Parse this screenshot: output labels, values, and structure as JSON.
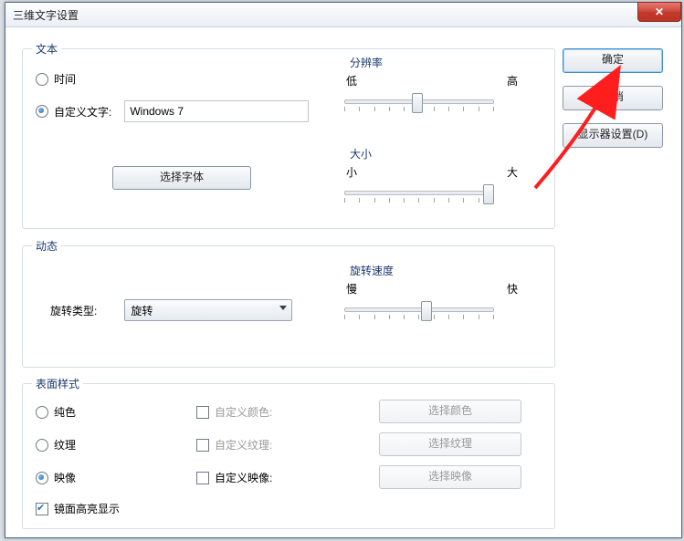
{
  "window": {
    "title": "三维文字设置"
  },
  "sidebar": {
    "ok": "确定",
    "cancel": "取消",
    "monitor": "显示器设置(D)"
  },
  "text_group": {
    "legend": "文本",
    "time_label": "时间",
    "custom_text_label": "自定义文字:",
    "custom_text_value": "Windows 7",
    "choose_font": "选择字体",
    "resolution": {
      "legend": "分辨率",
      "low": "低",
      "high": "高"
    },
    "size": {
      "legend": "大小",
      "small": "小",
      "big": "大"
    }
  },
  "motion_group": {
    "legend": "动态",
    "type_label": "旋转类型:",
    "type_value": "旋转",
    "speed": {
      "legend": "旋转速度",
      "slow": "慢",
      "fast": "快"
    }
  },
  "surface_group": {
    "legend": "表面样式",
    "solid": "纯色",
    "texture": "纹理",
    "reflection": "映像",
    "custom_color": "自定义颜色:",
    "custom_texture": "自定义纹理:",
    "custom_reflection": "自定义映像:",
    "choose_color": "选择颜色",
    "choose_texture": "选择纹理",
    "choose_reflection": "选择映像",
    "specular": "镜面高亮显示"
  }
}
